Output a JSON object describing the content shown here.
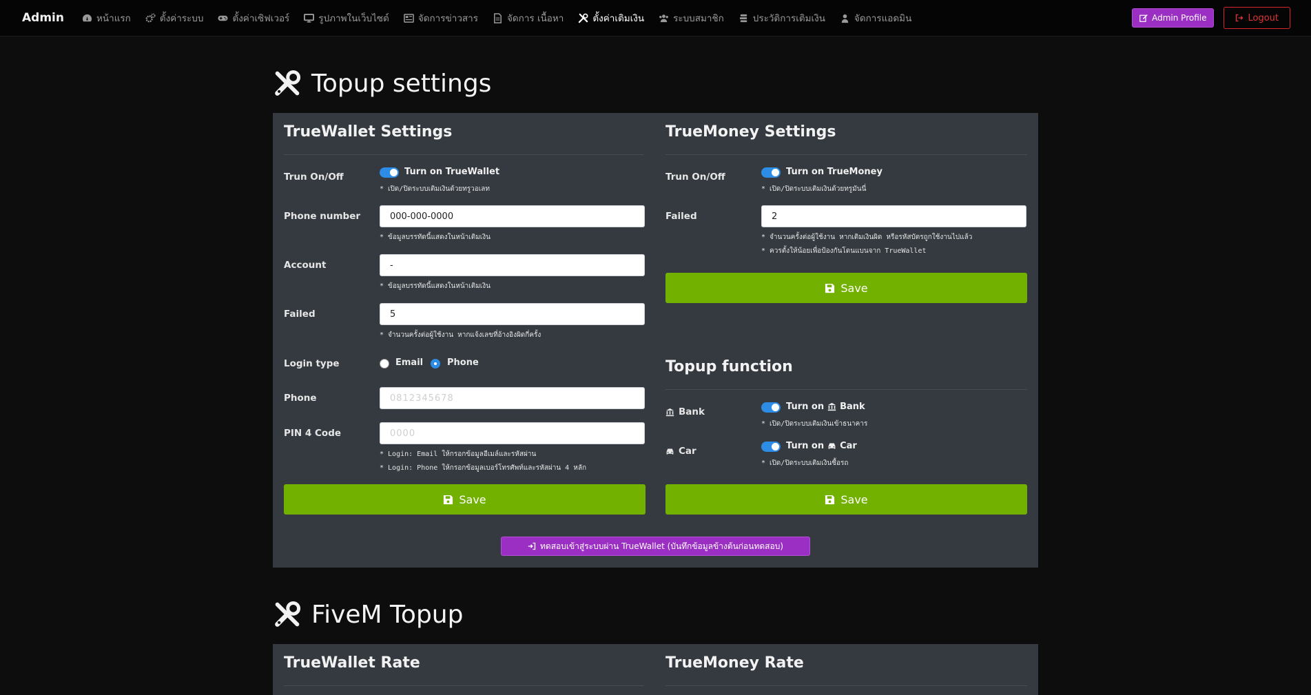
{
  "navbar": {
    "brand": "Admin",
    "items": [
      {
        "label": "หน้าแรก",
        "icon": "dashboard-icon"
      },
      {
        "label": "ตั้งค่าระบบ",
        "icon": "cogs-icon"
      },
      {
        "label": "ตั้งค่าเซิฟเวอร์",
        "icon": "gamepad-icon"
      },
      {
        "label": "รูปภาพในเว็บไซต์",
        "icon": "desktop-icon"
      },
      {
        "label": "จัดการข่าวสาร",
        "icon": "newspaper-icon"
      },
      {
        "label": "จัดการ เนื้อหา",
        "icon": "file-icon"
      },
      {
        "label": "ตั้งค่าเติมเงิน",
        "icon": "tools-icon"
      },
      {
        "label": "ระบบสมาชิก",
        "icon": "users-icon"
      },
      {
        "label": "ประวัติการเติมเงิน",
        "icon": "money-stack-icon"
      },
      {
        "label": "จัดการแอดมิน",
        "icon": "user-secret-icon"
      }
    ],
    "active_index": 6,
    "profile_label": "Admin Profile",
    "logout_label": "Logout"
  },
  "topup": {
    "heading": "Topup settings",
    "truewallet": {
      "title": "TrueWallet Settings",
      "toggle_label": "Trun On/Off",
      "toggle_text": "Turn on TrueWallet",
      "toggle_hint": "* เปิด/ปิดระบบเติมเงินด้วยทรูวอเลท",
      "phone_label": "Phone number",
      "phone_value": "000-000-0000",
      "phone_hint": "* ข้อมูลบรรทัดนี้แสดงในหน้าเติมเงิน",
      "account_label": "Account",
      "account_value": "-",
      "account_hint": "* ข้อมูลบรรทัดนี้แสดงในหน้าเติมเงิน",
      "failed_label": "Failed",
      "failed_value": "5",
      "failed_hint": "* จำนวนครั้งต่อผู้ใช้งาน หากแจ้งเลขที่อ้างอิงผิดกี่ครั้ง",
      "login_type_label": "Login type",
      "login_email": "Email",
      "login_phone": "Phone",
      "login_selected": "Phone",
      "phone2_label": "Phone",
      "phone2_value": "0812345678",
      "pin_label": "PIN 4 Code",
      "pin_value": "0000",
      "login_hint_1": "* Login: Email ให้กรอกข้อมูลอีเมล์และรหัสผ่าน",
      "login_hint_2": "* Login: Phone ให้กรอกข้อมูลเบอร์โทรศัพท์และรหัสผ่าน 4 หลัก",
      "save_label": "Save"
    },
    "truemoney": {
      "title": "TrueMoney Settings",
      "toggle_label": "Trun On/Off",
      "toggle_text": "Turn on TrueMoney",
      "toggle_hint": "* เปิด/ปิดระบบเติมเงินด้วยทรูมันนี่",
      "failed_label": "Failed",
      "failed_value": "2",
      "failed_hint_1": "* จำนวนครั้งต่อผู้ใช้งาน หากเติมเงินผิด หรือรหัสบัตรถูกใช้งานไปแล้ว",
      "failed_hint_2": "* ควรตั้งให้น้อยเพื่อป้องกันโดนแบนจาก TrueWallet",
      "save_label": "Save"
    },
    "topup_function": {
      "title": "Topup function",
      "bank_label": "Bank",
      "bank_toggle_prefix": "Turn on",
      "bank_toggle_suffix": "Bank",
      "bank_hint": "* เปิด/ปิดระบบเติมเงินเข้าธนาคาร",
      "car_label": "Car",
      "car_toggle_prefix": "Turn on",
      "car_toggle_suffix": "Car",
      "car_hint": "* เปิด/ปิดระบบเติมเงินซื้อรถ",
      "save_label": "Save"
    },
    "test_button_label": "ทดสอบเข้าสู่ระบบผ่าน TrueWallet (บันทึกข้อมูลข้างต้นก่อนทดสอบ)"
  },
  "fivem": {
    "heading": "FiveM Topup",
    "truewallet_rate_title": "TrueWallet Rate",
    "truemoney_rate_title": "TrueMoney Rate"
  },
  "colors": {
    "save_green": "#73b100",
    "purple": "#9b2fc3",
    "logout_red": "#d7262b",
    "switch_blue": "#2d8ce6",
    "panel_bg": "#343a40"
  }
}
